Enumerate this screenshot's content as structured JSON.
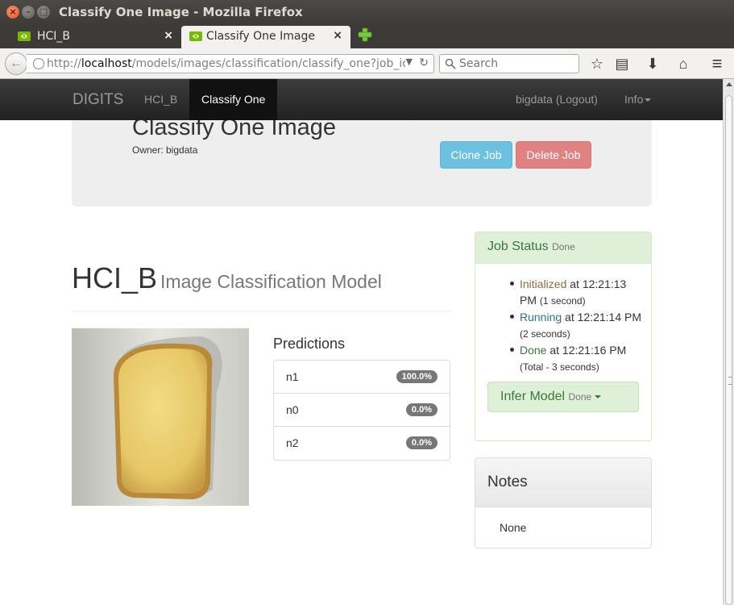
{
  "window": {
    "title": "Classify One Image - Mozilla Firefox",
    "close_glyph": "×",
    "min_glyph": "–",
    "max_glyph": "□"
  },
  "tabs": [
    {
      "label": "HCI_B",
      "icon": "nvidia-icon",
      "close": "×"
    },
    {
      "label": "Classify One Image",
      "icon": "nvidia-icon",
      "close": "×",
      "active": true
    }
  ],
  "toolbar": {
    "back_glyph": "←",
    "url_scheme": "http://",
    "url_host": "localhost",
    "url_path": "/models/images/classification/classify_one?job_id",
    "url_drop_glyph": "▼",
    "reload_glyph": "↻",
    "search_placeholder": "Search",
    "bookmark_glyph": "☆",
    "reader_glyph": "▤",
    "download_glyph": "⬇",
    "home_glyph": "⌂",
    "menu_glyph": "≡"
  },
  "app": {
    "brand": "DIGITS",
    "nav": [
      {
        "label": "HCI_B"
      },
      {
        "label": "Classify One"
      }
    ],
    "user": "bigdata (Logout)",
    "info": "Info"
  },
  "job": {
    "title": "Classify One Image",
    "owner": "Owner: bigdata",
    "clone_label": "Clone Job",
    "delete_label": "Delete Job"
  },
  "model": {
    "name": "HCI_B",
    "subtitle": "Image Classification Model"
  },
  "predictions": {
    "title": "Predictions",
    "items": [
      {
        "label": "n1",
        "value": "100.0%"
      },
      {
        "label": "n0",
        "value": "0.0%"
      },
      {
        "label": "n2",
        "value": "0.0%"
      }
    ]
  },
  "job_status": {
    "title": "Job Status",
    "state": "Done",
    "events": [
      {
        "name": "Initialized",
        "at": " at 12:21:13 PM",
        "duration": "(1 second)"
      },
      {
        "name": "Running",
        "at": " at 12:21:14 PM",
        "duration": "(2 seconds)"
      },
      {
        "name": "Done",
        "at": " at 12:21:16 PM",
        "duration": "(Total - 3 seconds)"
      }
    ],
    "infer_label": "Infer Model",
    "infer_state": "Done"
  },
  "notes": {
    "title": "Notes",
    "body": "None"
  },
  "colors": {
    "navbar": "#222222",
    "clone": "#6cc0e0",
    "delete": "#e08281",
    "success_bg": "#dff0d8",
    "success_text": "#3c763d",
    "badge": "#777777"
  }
}
